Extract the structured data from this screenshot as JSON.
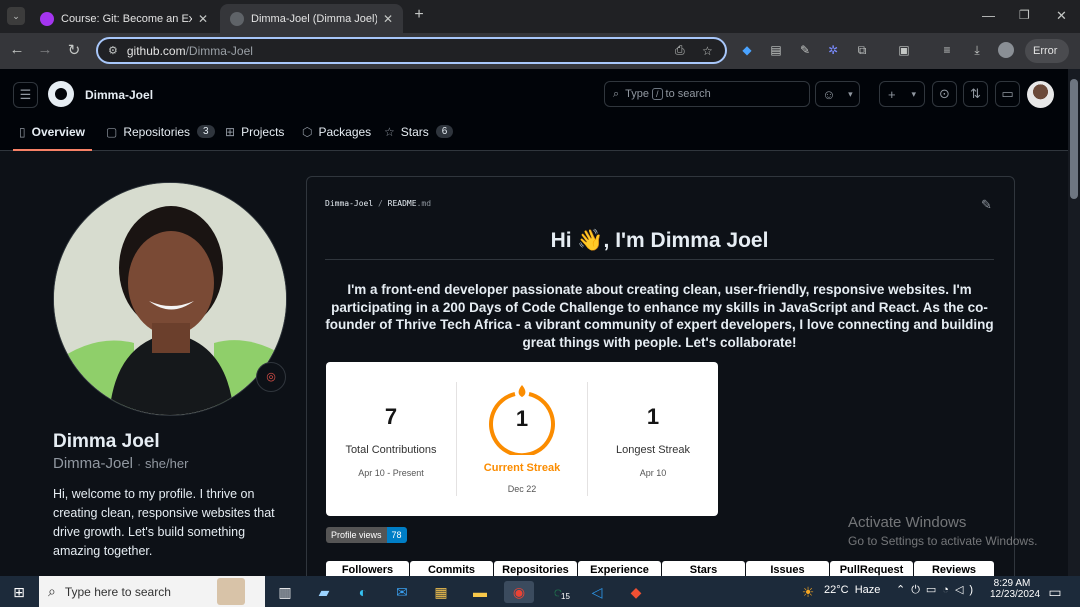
{
  "browser": {
    "tabs": [
      {
        "title": "Course: Git: Become an Expert in",
        "active": false
      },
      {
        "title": "Dimma-Joel (Dimma Joel)",
        "active": true
      }
    ],
    "new_tab": "+",
    "url_domain": "github.com",
    "url_path": "/Dimma-Joel",
    "error_label": "Error"
  },
  "header": {
    "username": "Dimma-Joel",
    "search_placeholder_pre": "Type",
    "search_key": "/",
    "search_placeholder_post": "to search",
    "plus": "+"
  },
  "nav": {
    "tabs": [
      {
        "label": "Overview"
      },
      {
        "label": "Repositories",
        "count": "3"
      },
      {
        "label": "Projects"
      },
      {
        "label": "Packages"
      },
      {
        "label": "Stars",
        "count": "6"
      }
    ]
  },
  "profile": {
    "name": "Dimma Joel",
    "login": "Dimma-Joel",
    "pronouns": "she/her",
    "separator": "·",
    "bio": "Hi, welcome to my profile. I thrive on creating clean, responsive websites that drive growth. Let's build something amazing together."
  },
  "readme": {
    "path_user": "Dimma-Joel",
    "path_sep": "/",
    "path_file": "README",
    "path_ext": ".md",
    "heading": "Hi 👋, I'm Dimma Joel",
    "intro": "I'm a front-end developer passionate about creating clean, user-friendly, responsive websites. I'm participating in a 200 Days of Code Challenge to enhance my skills in JavaScript and React. As the co-founder of Thrive Tech Africa - a vibrant community of expert developers, I love connecting and building great things with people. Let's collaborate!"
  },
  "streak": {
    "total_value": "7",
    "total_label": "Total Contributions",
    "total_range": "Apr 10 - Present",
    "current_value": "1",
    "current_label": "Current Streak",
    "current_date": "Dec 22",
    "longest_value": "1",
    "longest_label": "Longest Streak",
    "longest_date": "Apr 10",
    "accent": "#fb8c00"
  },
  "views_badge": {
    "label": "Profile views",
    "value": "78"
  },
  "github_tabs": [
    "Followers",
    "Commits",
    "Repositories",
    "Experience",
    "Stars",
    "Issues",
    "PullRequest",
    "Reviews"
  ],
  "watermark": {
    "title": "Activate Windows",
    "subtitle": "Go to Settings to activate Windows."
  },
  "taskbar": {
    "search_placeholder": "Type here to search",
    "weather": "22°C  Haze",
    "time": "8:29 AM",
    "date": "12/23/2024",
    "whatsapp_badge": "15"
  }
}
